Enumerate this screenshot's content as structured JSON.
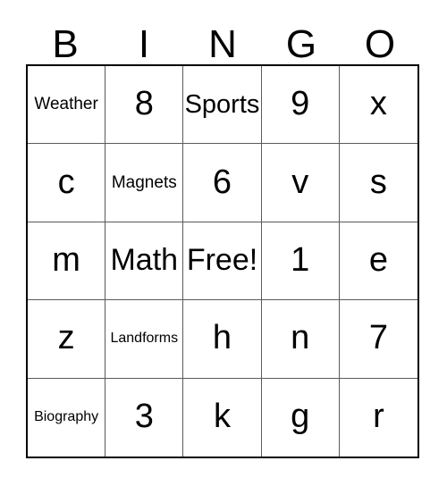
{
  "card": {
    "title": "BINGO",
    "header_letters": [
      "B",
      "I",
      "N",
      "G",
      "O"
    ],
    "free_space_label": "Free!",
    "colors": {
      "background": "#ffffff",
      "text": "#000000",
      "outer_border": "#000000",
      "grid_line": "#5a5a5a"
    },
    "grid": {
      "columns": 5,
      "rows": 5,
      "cells": [
        {
          "text": "Weather",
          "size": "t-md",
          "column": "B",
          "row": 1
        },
        {
          "text": "8",
          "size": "t-xl",
          "column": "I",
          "row": 1
        },
        {
          "text": "Sports",
          "size": "t-lg",
          "column": "N",
          "row": 1
        },
        {
          "text": "9",
          "size": "t-xl",
          "column": "G",
          "row": 1
        },
        {
          "text": "x",
          "size": "t-xl",
          "column": "O",
          "row": 1
        },
        {
          "text": "c",
          "size": "t-xl",
          "column": "B",
          "row": 2
        },
        {
          "text": "Magnets",
          "size": "t-md",
          "column": "I",
          "row": 2
        },
        {
          "text": "6",
          "size": "t-xl",
          "column": "N",
          "row": 2
        },
        {
          "text": "v",
          "size": "t-xl",
          "column": "G",
          "row": 2
        },
        {
          "text": "s",
          "size": "t-xl",
          "column": "O",
          "row": 2
        },
        {
          "text": "m",
          "size": "t-xl",
          "column": "B",
          "row": 3
        },
        {
          "text": "Math",
          "size": "t-lg",
          "column": "I",
          "row": 3
        },
        {
          "text": "Free!",
          "size": "t-lg",
          "column": "N",
          "row": 3
        },
        {
          "text": "1",
          "size": "t-xl",
          "column": "G",
          "row": 3
        },
        {
          "text": "e",
          "size": "t-xl",
          "column": "O",
          "row": 3
        },
        {
          "text": "z",
          "size": "t-xl",
          "column": "B",
          "row": 4
        },
        {
          "text": "Landforms",
          "size": "t-sm",
          "column": "I",
          "row": 4
        },
        {
          "text": "h",
          "size": "t-xl",
          "column": "N",
          "row": 4
        },
        {
          "text": "n",
          "size": "t-xl",
          "column": "G",
          "row": 4
        },
        {
          "text": "7",
          "size": "t-xl",
          "column": "O",
          "row": 4
        },
        {
          "text": "Biography",
          "size": "t-sm",
          "column": "B",
          "row": 5
        },
        {
          "text": "3",
          "size": "t-xl",
          "column": "I",
          "row": 5
        },
        {
          "text": "k",
          "size": "t-xl",
          "column": "N",
          "row": 5
        },
        {
          "text": "g",
          "size": "t-xl",
          "column": "G",
          "row": 5
        },
        {
          "text": "r",
          "size": "t-xl",
          "column": "O",
          "row": 5
        }
      ]
    }
  }
}
